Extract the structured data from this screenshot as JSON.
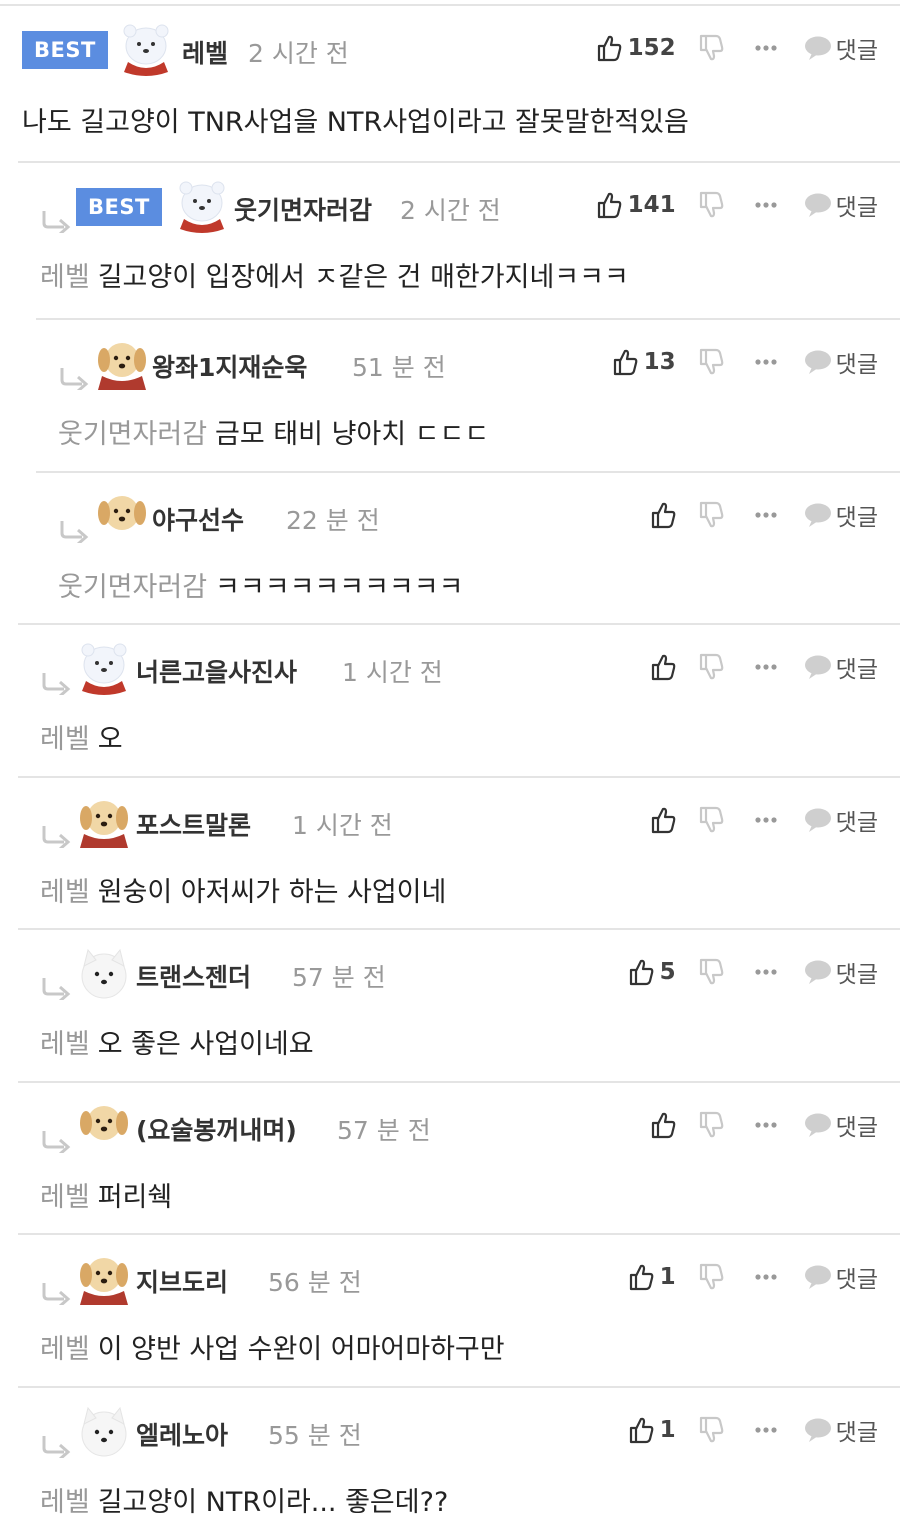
{
  "labels": {
    "reply": "댓글",
    "best": "BEST"
  },
  "comments": [
    {
      "nick": "레벨",
      "time": "2 시간 전",
      "likes": "152",
      "best": true,
      "mention": "",
      "text": "나도 길고양이 TNR사업을 NTR사업이라고 잘못말한적있음",
      "avatar": "bear"
    },
    {
      "nick": "웃기면자러감",
      "time": "2 시간 전",
      "likes": "141",
      "best": true,
      "mention": "레벨",
      "text": "길고양이 입장에서 ㅈ같은 건 매한가지네ㅋㅋㅋ",
      "avatar": "bear"
    },
    {
      "nick": "왕좌1지재순욱",
      "time": "51 분 전",
      "likes": "13",
      "best": false,
      "mention": "웃기면자러감",
      "text": "금모 태비 냥아치 ㄷㄷㄷ",
      "avatar": "dog-cape"
    },
    {
      "nick": "야구선수",
      "time": "22 분 전",
      "likes": "",
      "best": false,
      "mention": "웃기면자러감",
      "text": "ㅋㅋㅋㅋㅋㅋㅋㅋㅋㅋ",
      "avatar": "dog"
    },
    {
      "nick": "너른고을사진사",
      "time": "1 시간 전",
      "likes": "",
      "best": false,
      "mention": "레벨",
      "text": "오",
      "avatar": "bear"
    },
    {
      "nick": "포스트말론",
      "time": "1 시간 전",
      "likes": "",
      "best": false,
      "mention": "레벨",
      "text": "원숭이 아저씨가 하는 사업이네",
      "avatar": "dog-cape"
    },
    {
      "nick": "트랜스젠더",
      "time": "57 분 전",
      "likes": "5",
      "best": false,
      "mention": "레벨",
      "text": "오 좋은 사업이네요",
      "avatar": "white-dog"
    },
    {
      "nick": "(요술봉꺼내며)",
      "time": "57 분 전",
      "likes": "",
      "best": false,
      "mention": "레벨",
      "text": "퍼리쉑",
      "avatar": "dog-face"
    },
    {
      "nick": "지브도리",
      "time": "56 분 전",
      "likes": "1",
      "best": false,
      "mention": "레벨",
      "text": "이 양반 사업 수완이 어마어마하구만",
      "avatar": "dog-cape"
    },
    {
      "nick": "엘레노아",
      "time": "55 분 전",
      "likes": "1",
      "best": false,
      "mention": "레벨",
      "text": "길고양이 NTR이라... 좋은데??",
      "avatar": "white-dog"
    }
  ]
}
